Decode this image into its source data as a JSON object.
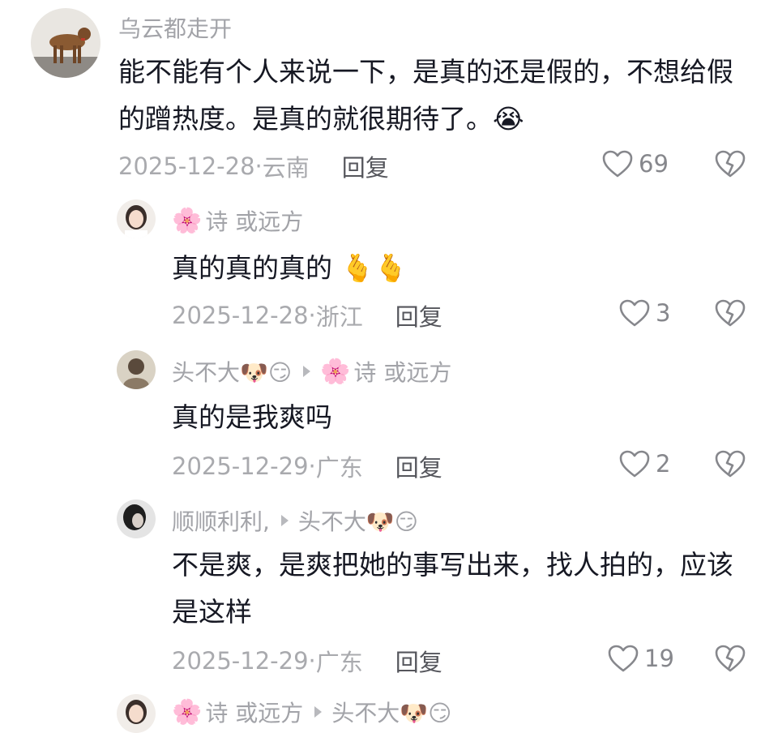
{
  "comments": [
    {
      "user": "乌云都走开",
      "text": "能不能有个人来说一下，是真的还是假的，不想给假的蹭热度。是真的就很期待了。😭",
      "date": "2025-12-28",
      "location": "云南",
      "reply_label": "回复",
      "likes": "69"
    },
    {
      "user_prefix": "🌸",
      "user": "诗 或远方",
      "text": "真的真的真的 🫰🫰",
      "date": "2025-12-28",
      "location": "浙江",
      "reply_label": "回复",
      "likes": "3"
    },
    {
      "user": "头不大🐶😏",
      "reply_to_prefix": "🌸",
      "reply_to": "诗 或远方",
      "text": "真的是我爽吗",
      "date": "2025-12-29",
      "location": "广东",
      "reply_label": "回复",
      "likes": "2"
    },
    {
      "user": "顺顺利利,",
      "reply_to": "头不大🐶😏",
      "text": "不是爽，是爽把她的事写出来，找人拍的，应该是这样",
      "date": "2025-12-29",
      "location": "广东",
      "reply_label": "回复",
      "likes": "19"
    },
    {
      "user_prefix": "🌸",
      "user": "诗 或远方",
      "reply_to": "头不大🐶😏"
    }
  ],
  "icons": {
    "like": "heart-outline-icon",
    "dislike": "broken-heart-icon"
  },
  "colors": {
    "username": "#a2a3a8",
    "meta": "#a9aaae",
    "reply": "#55565c"
  }
}
